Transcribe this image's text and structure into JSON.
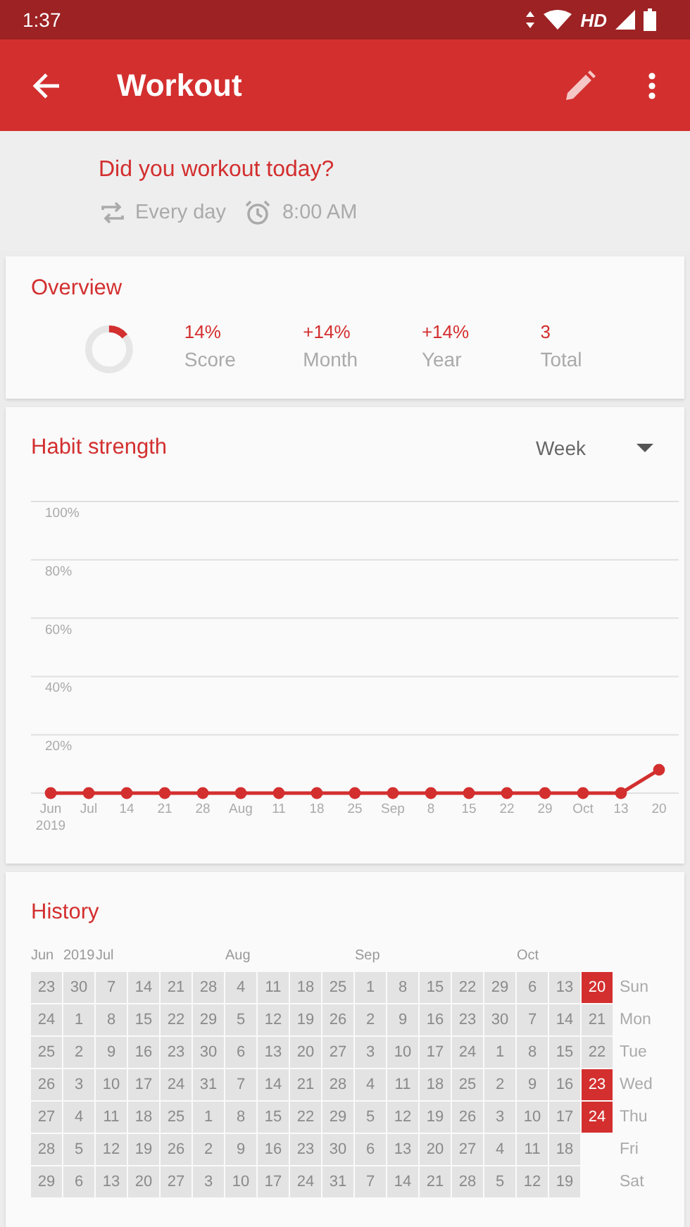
{
  "status_bar": {
    "time": "1:37",
    "network": "HD"
  },
  "app_bar": {
    "title": "Workout"
  },
  "habit": {
    "question": "Did you workout today?",
    "frequency": "Every day",
    "reminder": "8:00 AM"
  },
  "overview": {
    "title": "Overview",
    "score_ring": {
      "level": 0.14
    },
    "stats": [
      {
        "value": "14%",
        "label": "Score"
      },
      {
        "value": "+14%",
        "label": "Month"
      },
      {
        "value": "+14%",
        "label": "Year"
      },
      {
        "value": "3",
        "label": "Total"
      }
    ]
  },
  "habit_strength": {
    "title": "Habit strength",
    "period": "Week",
    "chart_data": {
      "type": "line",
      "categories": [
        "Jun 2019",
        "Jul",
        "14",
        "21",
        "28",
        "Aug",
        "11",
        "18",
        "25",
        "Sep",
        "8",
        "15",
        "22",
        "29",
        "Oct",
        "13",
        "20"
      ],
      "grid": true,
      "series": [
        {
          "color": "#d32f2f",
          "marker": "circle",
          "values": [
            0,
            0,
            0,
            0,
            0,
            0,
            0,
            0,
            0,
            0,
            0,
            0,
            0,
            0,
            0,
            0,
            8
          ]
        }
      ],
      "ylim": [
        0,
        100
      ],
      "yticks": [
        {
          "value": 20,
          "label": "20%"
        },
        {
          "value": 40,
          "label": "40%"
        },
        {
          "value": 60,
          "label": "60%"
        },
        {
          "value": 80,
          "label": "80%"
        },
        {
          "value": 100,
          "label": "100%"
        }
      ]
    }
  },
  "history": {
    "title": "History",
    "weekdays": [
      "Sun",
      "Mon",
      "Tue",
      "Wed",
      "Thu",
      "Fri",
      "Sat"
    ],
    "weeks": [
      {
        "header": "Jun",
        "days": [
          {
            "text": "23",
            "done": false
          },
          {
            "text": "24",
            "done": false
          },
          {
            "text": "25",
            "done": false
          },
          {
            "text": "26",
            "done": false
          },
          {
            "text": "27",
            "done": false
          },
          {
            "text": "28",
            "done": false
          },
          {
            "text": "29",
            "done": false
          }
        ]
      },
      {
        "header": "2019",
        "days": [
          {
            "text": "30",
            "done": false
          },
          {
            "text": "1",
            "done": false
          },
          {
            "text": "2",
            "done": false
          },
          {
            "text": "3",
            "done": false
          },
          {
            "text": "4",
            "done": false
          },
          {
            "text": "5",
            "done": false
          },
          {
            "text": "6",
            "done": false
          }
        ]
      },
      {
        "header": "Jul",
        "days": [
          {
            "text": "7",
            "done": false
          },
          {
            "text": "8",
            "done": false
          },
          {
            "text": "9",
            "done": false
          },
          {
            "text": "10",
            "done": false
          },
          {
            "text": "11",
            "done": false
          },
          {
            "text": "12",
            "done": false
          },
          {
            "text": "13",
            "done": false
          }
        ]
      },
      {
        "days": [
          {
            "text": "14",
            "done": false
          },
          {
            "text": "15",
            "done": false
          },
          {
            "text": "16",
            "done": false
          },
          {
            "text": "17",
            "done": false
          },
          {
            "text": "18",
            "done": false
          },
          {
            "text": "19",
            "done": false
          },
          {
            "text": "20",
            "done": false
          }
        ]
      },
      {
        "days": [
          {
            "text": "21",
            "done": false
          },
          {
            "text": "22",
            "done": false
          },
          {
            "text": "23",
            "done": false
          },
          {
            "text": "24",
            "done": false
          },
          {
            "text": "25",
            "done": false
          },
          {
            "text": "26",
            "done": false
          },
          {
            "text": "27",
            "done": false
          }
        ]
      },
      {
        "days": [
          {
            "text": "28",
            "done": false
          },
          {
            "text": "29",
            "done": false
          },
          {
            "text": "30",
            "done": false
          },
          {
            "text": "31",
            "done": false
          },
          {
            "text": "1",
            "done": false
          },
          {
            "text": "2",
            "done": false
          },
          {
            "text": "3",
            "done": false
          }
        ]
      },
      {
        "header": "Aug",
        "days": [
          {
            "text": "4",
            "done": false
          },
          {
            "text": "5",
            "done": false
          },
          {
            "text": "6",
            "done": false
          },
          {
            "text": "7",
            "done": false
          },
          {
            "text": "8",
            "done": false
          },
          {
            "text": "9",
            "done": false
          },
          {
            "text": "10",
            "done": false
          }
        ]
      },
      {
        "days": [
          {
            "text": "11",
            "done": false
          },
          {
            "text": "12",
            "done": false
          },
          {
            "text": "13",
            "done": false
          },
          {
            "text": "14",
            "done": false
          },
          {
            "text": "15",
            "done": false
          },
          {
            "text": "16",
            "done": false
          },
          {
            "text": "17",
            "done": false
          }
        ]
      },
      {
        "days": [
          {
            "text": "18",
            "done": false
          },
          {
            "text": "19",
            "done": false
          },
          {
            "text": "20",
            "done": false
          },
          {
            "text": "21",
            "done": false
          },
          {
            "text": "22",
            "done": false
          },
          {
            "text": "23",
            "done": false
          },
          {
            "text": "24",
            "done": false
          }
        ]
      },
      {
        "days": [
          {
            "text": "25",
            "done": false
          },
          {
            "text": "26",
            "done": false
          },
          {
            "text": "27",
            "done": false
          },
          {
            "text": "28",
            "done": false
          },
          {
            "text": "29",
            "done": false
          },
          {
            "text": "30",
            "done": false
          },
          {
            "text": "31",
            "done": false
          }
        ]
      },
      {
        "header": "Sep",
        "days": [
          {
            "text": "1",
            "done": false
          },
          {
            "text": "2",
            "done": false
          },
          {
            "text": "3",
            "done": false
          },
          {
            "text": "4",
            "done": false
          },
          {
            "text": "5",
            "done": false
          },
          {
            "text": "6",
            "done": false
          },
          {
            "text": "7",
            "done": false
          }
        ]
      },
      {
        "days": [
          {
            "text": "8",
            "done": false
          },
          {
            "text": "9",
            "done": false
          },
          {
            "text": "10",
            "done": false
          },
          {
            "text": "11",
            "done": false
          },
          {
            "text": "12",
            "done": false
          },
          {
            "text": "13",
            "done": false
          },
          {
            "text": "14",
            "done": false
          }
        ]
      },
      {
        "days": [
          {
            "text": "15",
            "done": false
          },
          {
            "text": "16",
            "done": false
          },
          {
            "text": "17",
            "done": false
          },
          {
            "text": "18",
            "done": false
          },
          {
            "text": "19",
            "done": false
          },
          {
            "text": "20",
            "done": false
          },
          {
            "text": "21",
            "done": false
          }
        ]
      },
      {
        "days": [
          {
            "text": "22",
            "done": false
          },
          {
            "text": "23",
            "done": false
          },
          {
            "text": "24",
            "done": false
          },
          {
            "text": "25",
            "done": false
          },
          {
            "text": "26",
            "done": false
          },
          {
            "text": "27",
            "done": false
          },
          {
            "text": "28",
            "done": false
          }
        ]
      },
      {
        "days": [
          {
            "text": "29",
            "done": false
          },
          {
            "text": "30",
            "done": false
          },
          {
            "text": "1",
            "done": false
          },
          {
            "text": "2",
            "done": false
          },
          {
            "text": "3",
            "done": false
          },
          {
            "text": "4",
            "done": false
          },
          {
            "text": "5",
            "done": false
          }
        ]
      },
      {
        "header": "Oct",
        "days": [
          {
            "text": "6",
            "done": false
          },
          {
            "text": "7",
            "done": false
          },
          {
            "text": "8",
            "done": false
          },
          {
            "text": "9",
            "done": false
          },
          {
            "text": "10",
            "done": false
          },
          {
            "text": "11",
            "done": false
          },
          {
            "text": "12",
            "done": false
          }
        ]
      },
      {
        "days": [
          {
            "text": "13",
            "done": false
          },
          {
            "text": "14",
            "done": false
          },
          {
            "text": "15",
            "done": false
          },
          {
            "text": "16",
            "done": false
          },
          {
            "text": "17",
            "done": false
          },
          {
            "text": "18",
            "done": false
          },
          {
            "text": "19",
            "done": false
          }
        ]
      },
      {
        "days": [
          {
            "text": "20",
            "done": true
          },
          {
            "text": "21",
            "done": false
          },
          {
            "text": "22",
            "done": false
          },
          {
            "text": "23",
            "done": true
          },
          {
            "text": "24",
            "done": true
          }
        ]
      }
    ]
  }
}
